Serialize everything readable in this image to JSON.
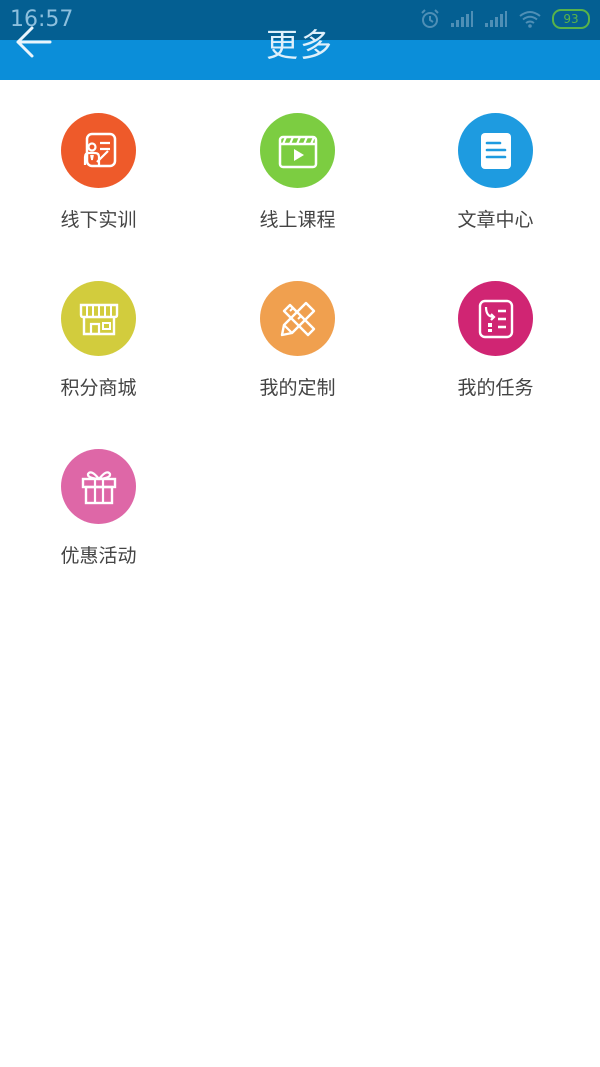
{
  "status_bar": {
    "time": "16:57",
    "battery": "93",
    "battery_color": "#58b34a"
  },
  "header": {
    "title": "更多",
    "back_icon": "arrow-left-icon",
    "color": "#0b8ed9"
  },
  "menu": [
    {
      "label": "线下实训",
      "icon": "offline-training-icon",
      "color": "#ee5a2a"
    },
    {
      "label": "线上课程",
      "icon": "video-course-icon",
      "color": "#7ccd41"
    },
    {
      "label": "文章中心",
      "icon": "article-icon",
      "color": "#1e9be0"
    },
    {
      "label": "积分商城",
      "icon": "store-icon",
      "color": "#d2cc3d"
    },
    {
      "label": "我的定制",
      "icon": "ruler-pencil-icon",
      "color": "#f0a04f"
    },
    {
      "label": "我的任务",
      "icon": "task-list-icon",
      "color": "#d02573"
    },
    {
      "label": "优惠活动",
      "icon": "gift-icon",
      "color": "#de67a7"
    }
  ]
}
